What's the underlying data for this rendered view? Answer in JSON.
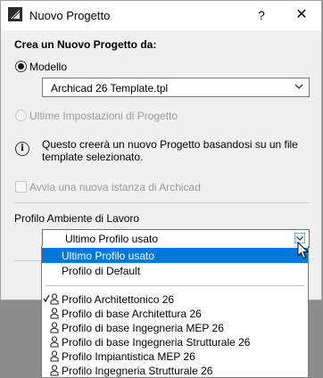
{
  "window": {
    "title": "Nuovo Progetto",
    "help_glyph": "?",
    "close_glyph": "✕"
  },
  "create": {
    "heading": "Crea un Nuovo Progetto da:",
    "option_template": "Modello",
    "template_value": "Archicad 26 Template.tpl",
    "option_last": "Ultime Impostazioni di Progetto",
    "info_text_line1": "Questo creerà un nuovo Progetto basandosi su un file",
    "info_text_line2": "template selezionato.",
    "new_instance": "Avvia una nuova istanza di Archicad"
  },
  "workspace": {
    "label": "Profilo Ambiente di Lavoro",
    "selected": "Ultimo Profilo usato",
    "options_top": [
      "Ultimo Profilo usato",
      "Profilo di Default"
    ],
    "profiles": [
      "Profilo Architettonico 26",
      "Profilo di base Architettura 26",
      "Profilo di base Ingegneria MEP 26",
      "Profilo di base Ingegneria Strutturale 26",
      "Profilo Impiantistica MEP 26",
      "Profilo Ingegneria Strutturale 26"
    ]
  },
  "colors": {
    "accent": "#0078d7",
    "disabled": "#9a9a9a",
    "backdrop": "#8c8c8c"
  },
  "icons": [
    "archicad-app-icon",
    "help-icon",
    "close-icon",
    "info-icon",
    "chevron-down-icon",
    "checkmark-icon",
    "user-profile-icon",
    "mouse-cursor-icon"
  ]
}
